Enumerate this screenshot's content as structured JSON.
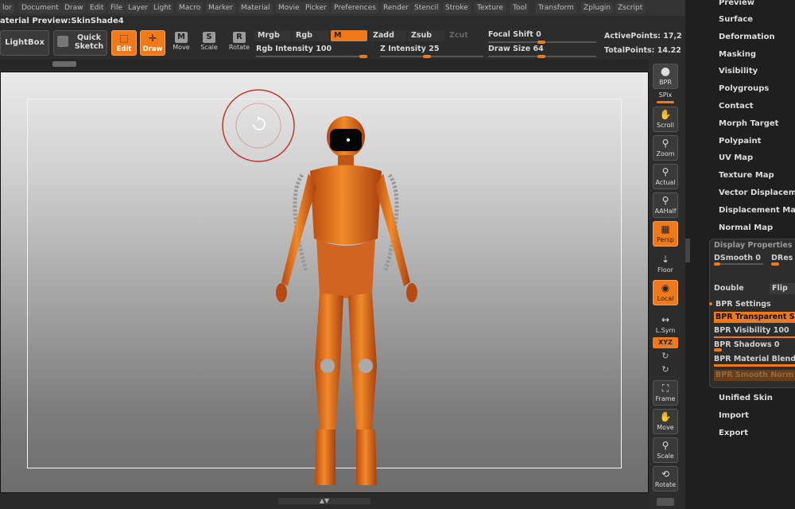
{
  "menubar": [
    "lor",
    "Document",
    "Draw",
    "Edit",
    "File",
    "Layer",
    "Light",
    "Macro",
    "Marker",
    "Material",
    "Movie",
    "Picker",
    "Preferences",
    "Render",
    "Stencil",
    "Stroke",
    "Texture",
    "Tool",
    "Transform",
    "Zplugin",
    "Zscript"
  ],
  "title": "aterial Preview:SkinShade4",
  "toolbar": {
    "lightbox": "LightBox",
    "quick_sketch": "Quick Sketch",
    "edit": "Edit",
    "draw": "Draw",
    "move": "Move",
    "scale": "Scale",
    "rotate": "Rotate",
    "mrgb": "Mrgb",
    "rgb": "Rgb",
    "m": "M",
    "zadd": "Zadd",
    "zsub": "Zsub",
    "zcut": "Zcut",
    "rgb_intensity_label": "Rgb Intensity",
    "rgb_intensity_value": "100",
    "z_intensity_label": "Z Intensity",
    "z_intensity_value": "25",
    "focal_shift_label": "Focal Shift",
    "focal_shift_value": "0",
    "draw_size_label": "Draw Size",
    "draw_size_value": "64",
    "active_points": "ActivePoints: 17,2",
    "total_points": "TotalPoints: 14.22"
  },
  "shelf": {
    "bpr": "BPR",
    "spix": "SPix",
    "scroll": "Scroll",
    "zoom": "Zoom",
    "actual": "Actual",
    "aahalf": "AAHalf",
    "persp": "Persp",
    "floor": "Floor",
    "local": "Local",
    "lsym": "L.Sym",
    "xyz": "XYZ",
    "frame": "Frame",
    "move": "Move",
    "scale": "Scale",
    "rotate": "Rotate"
  },
  "panel": {
    "items_top": [
      "Preview",
      "Surface",
      "Deformation",
      "Masking",
      "Visibility",
      "Polygroups",
      "Contact",
      "Morph Target",
      "Polypaint",
      "UV Map",
      "Texture Map",
      "Vector Displaceme",
      "Displacement Map",
      "Normal Map"
    ],
    "display_properties": "Display Properties",
    "dsmooth_label": "DSmooth",
    "dsmooth_value": "0",
    "dres": "DRes",
    "double": "Double",
    "flip": "Flip",
    "bpr_settings": "BPR Settings",
    "bpr_transparent": "BPR Transparent S",
    "bpr_visibility": "BPR Visibility 100",
    "bpr_shadows": "BPR Shadows 0",
    "bpr_material_blend": "BPR Material Blend",
    "bpr_smooth_normals": "BPR Smooth Norm",
    "items_bottom": [
      "Unified Skin",
      "Import",
      "Export"
    ]
  },
  "colors": {
    "accent": "#f07a1a",
    "panel_bg": "#1f1f1f",
    "canvas_top": "#eaeaea",
    "canvas_bottom": "#6d6d6d"
  },
  "icons": {
    "cursor": "rotate-cursor-icon"
  }
}
